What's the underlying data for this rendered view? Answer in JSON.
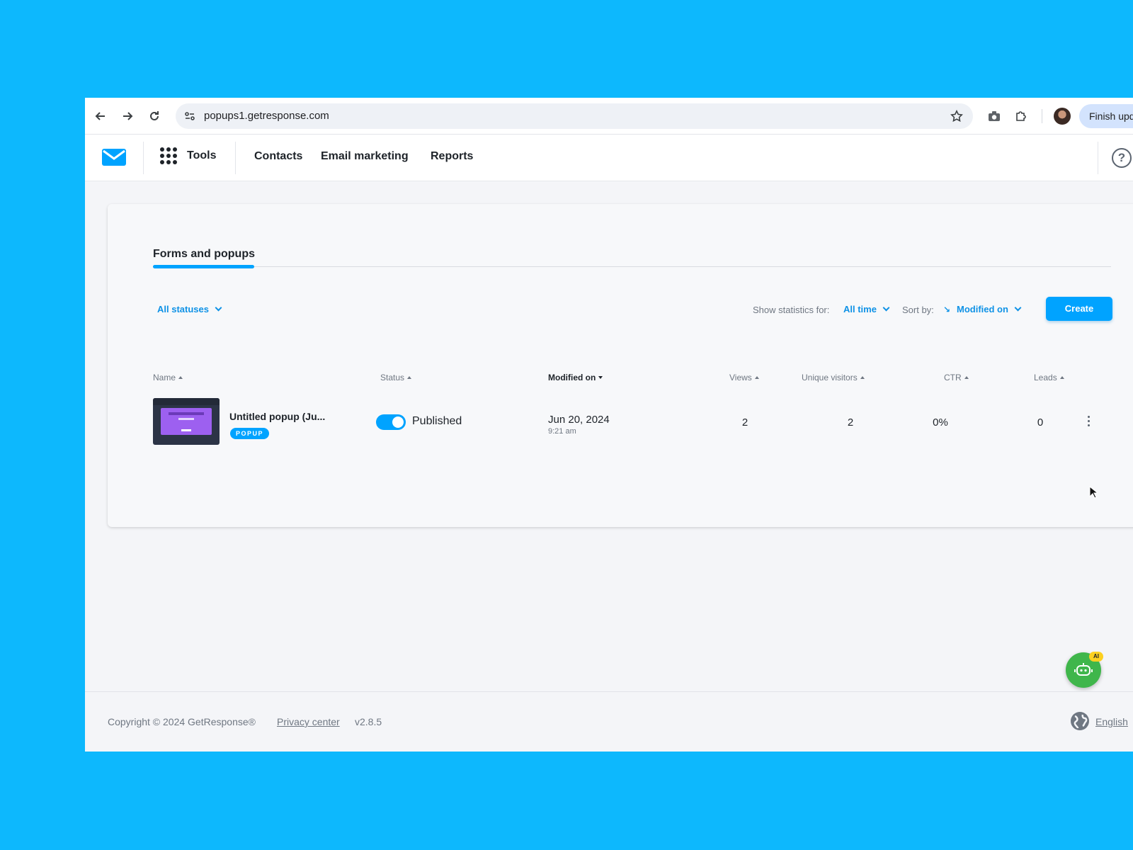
{
  "browser": {
    "url": "popups1.getresponse.com",
    "finish_update_label": "Finish upd"
  },
  "header": {
    "tools_label": "Tools",
    "nav": [
      "Contacts",
      "Email marketing",
      "Reports"
    ],
    "help_label": "?"
  },
  "page": {
    "tab_label": "Forms and popups",
    "status_filter": "All statuses",
    "stats_label": "Show statistics for:",
    "stats_value": "All time",
    "sort_label": "Sort by:",
    "sort_value": "Modified on",
    "create_label": "Create"
  },
  "table": {
    "columns": [
      "Name",
      "Status",
      "Modified on",
      "Views",
      "Unique visitors",
      "CTR",
      "Leads"
    ],
    "rows": [
      {
        "name": "Untitled popup (Ju...",
        "type_badge": "POPUP",
        "status": "Published",
        "published": true,
        "modified_date": "Jun 20, 2024",
        "modified_time": "9:21 am",
        "views": "2",
        "unique_visitors": "2",
        "ctr": "0%",
        "leads": "0"
      }
    ]
  },
  "ai_assistant": {
    "badge": "AI"
  },
  "footer": {
    "copyright": "Copyright © 2024 GetResponse®",
    "privacy_link": "Privacy center",
    "version": "v2.8.5",
    "language": "English"
  },
  "colors": {
    "background": "#0db8fd",
    "accent": "#00a3ff",
    "link": "#0f92e6",
    "ai_button": "#3fb64b"
  }
}
